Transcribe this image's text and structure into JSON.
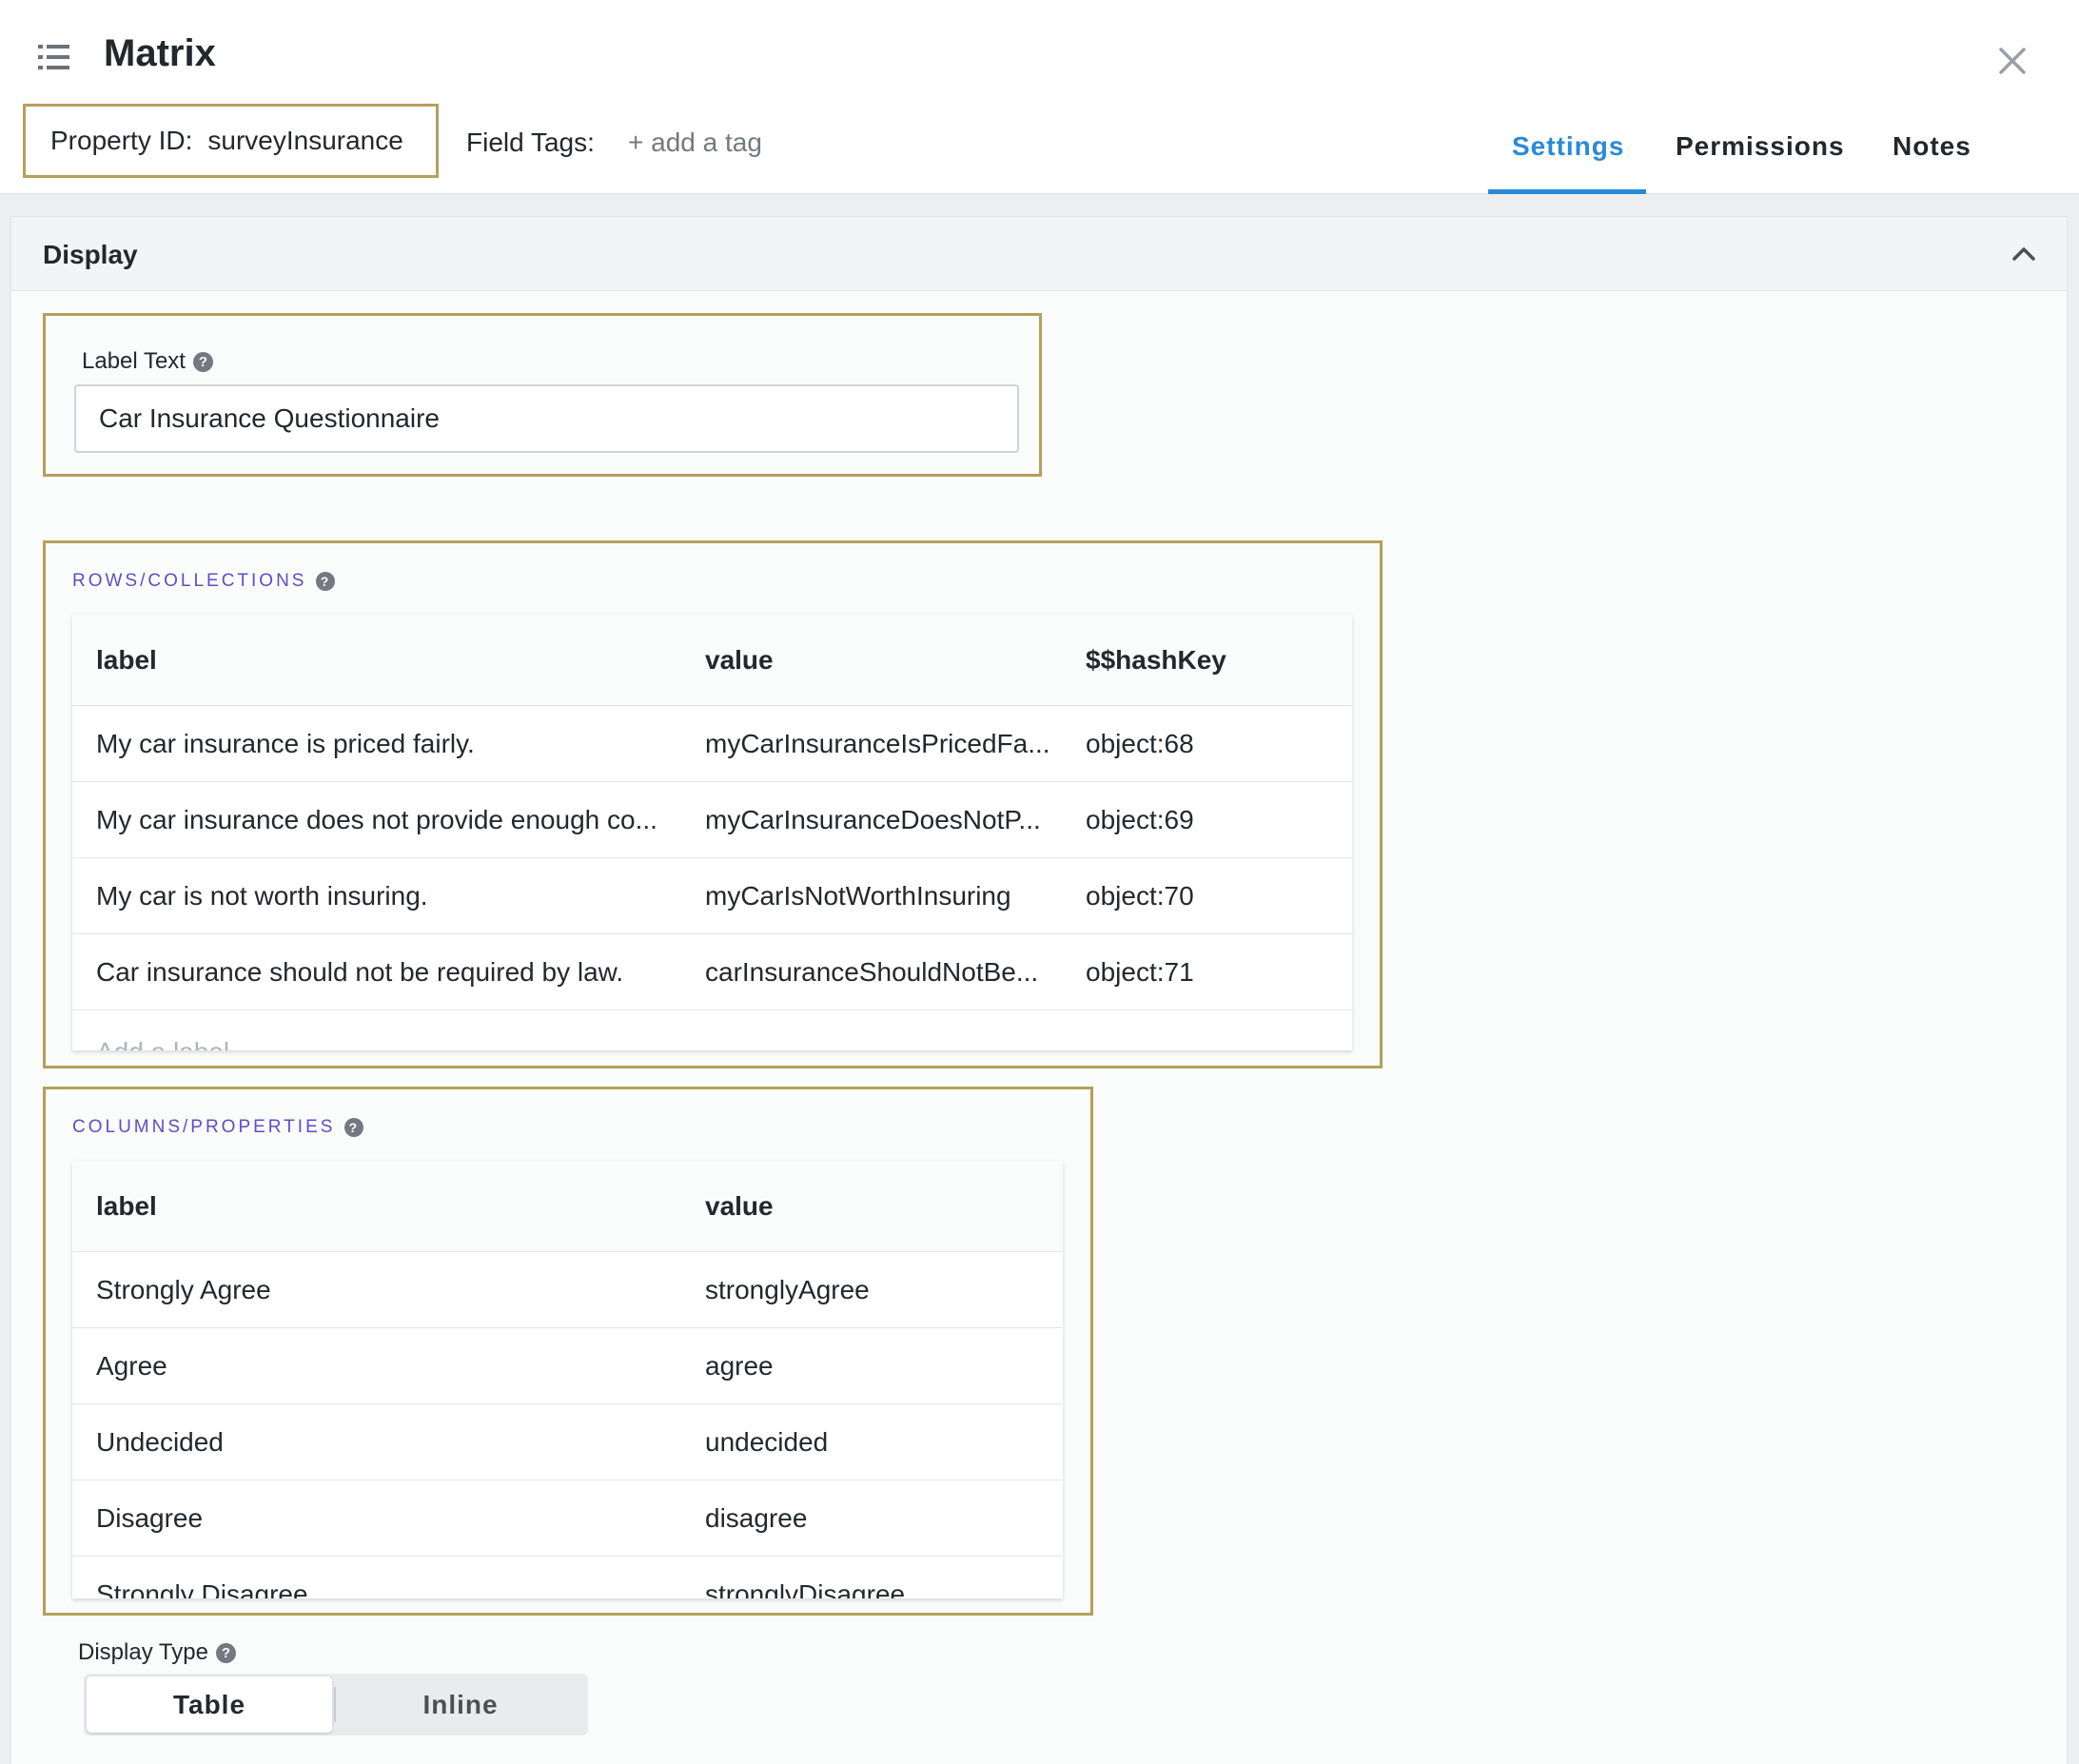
{
  "header": {
    "icon": "list-icon",
    "title": "Matrix",
    "close_icon": "close-icon",
    "property_id_label": "Property ID:",
    "property_id_value": "surveyInsurance",
    "field_tags_label": "Field Tags:",
    "add_tag": "+ add a tag",
    "tabs": [
      {
        "label": "Settings",
        "active": true
      },
      {
        "label": "Permissions",
        "active": false
      },
      {
        "label": "Notes",
        "active": false
      }
    ],
    "accent_color": "#2a8ad6"
  },
  "display": {
    "title": "Display",
    "collapse_icon": "chevron-up-icon",
    "label_text": {
      "label": "Label Text",
      "value": "Car Insurance Questionnaire"
    },
    "rows": {
      "title": "ROWS/COLLECTIONS",
      "headers": [
        "label",
        "value",
        "$$hashKey"
      ],
      "items": [
        [
          "My car insurance is priced fairly.",
          "myCarInsuranceIsPricedFa...",
          "object:68"
        ],
        [
          "My car insurance does not provide enough co...",
          "myCarInsuranceDoesNotP...",
          "object:69"
        ],
        [
          "My car is not worth insuring.",
          "myCarIsNotWorthInsuring",
          "object:70"
        ],
        [
          "Car insurance should not be required by law.",
          "carInsuranceShouldNotBe...",
          "object:71"
        ]
      ],
      "add_placeholder": "Add a label"
    },
    "columns": {
      "title": "COLUMNS/PROPERTIES",
      "headers": [
        "label",
        "value"
      ],
      "items": [
        [
          "Strongly Agree",
          "stronglyAgree"
        ],
        [
          "Agree",
          "agree"
        ],
        [
          "Undecided",
          "undecided"
        ],
        [
          "Disagree",
          "disagree"
        ],
        [
          "Strongly Disagree",
          "stronglyDisagree"
        ]
      ]
    },
    "display_type": {
      "label": "Display Type",
      "options": [
        "Table",
        "Inline"
      ],
      "selected": "Table"
    },
    "highlight_color": "#b59f5b",
    "section_label_color": "#5b4fc7"
  }
}
